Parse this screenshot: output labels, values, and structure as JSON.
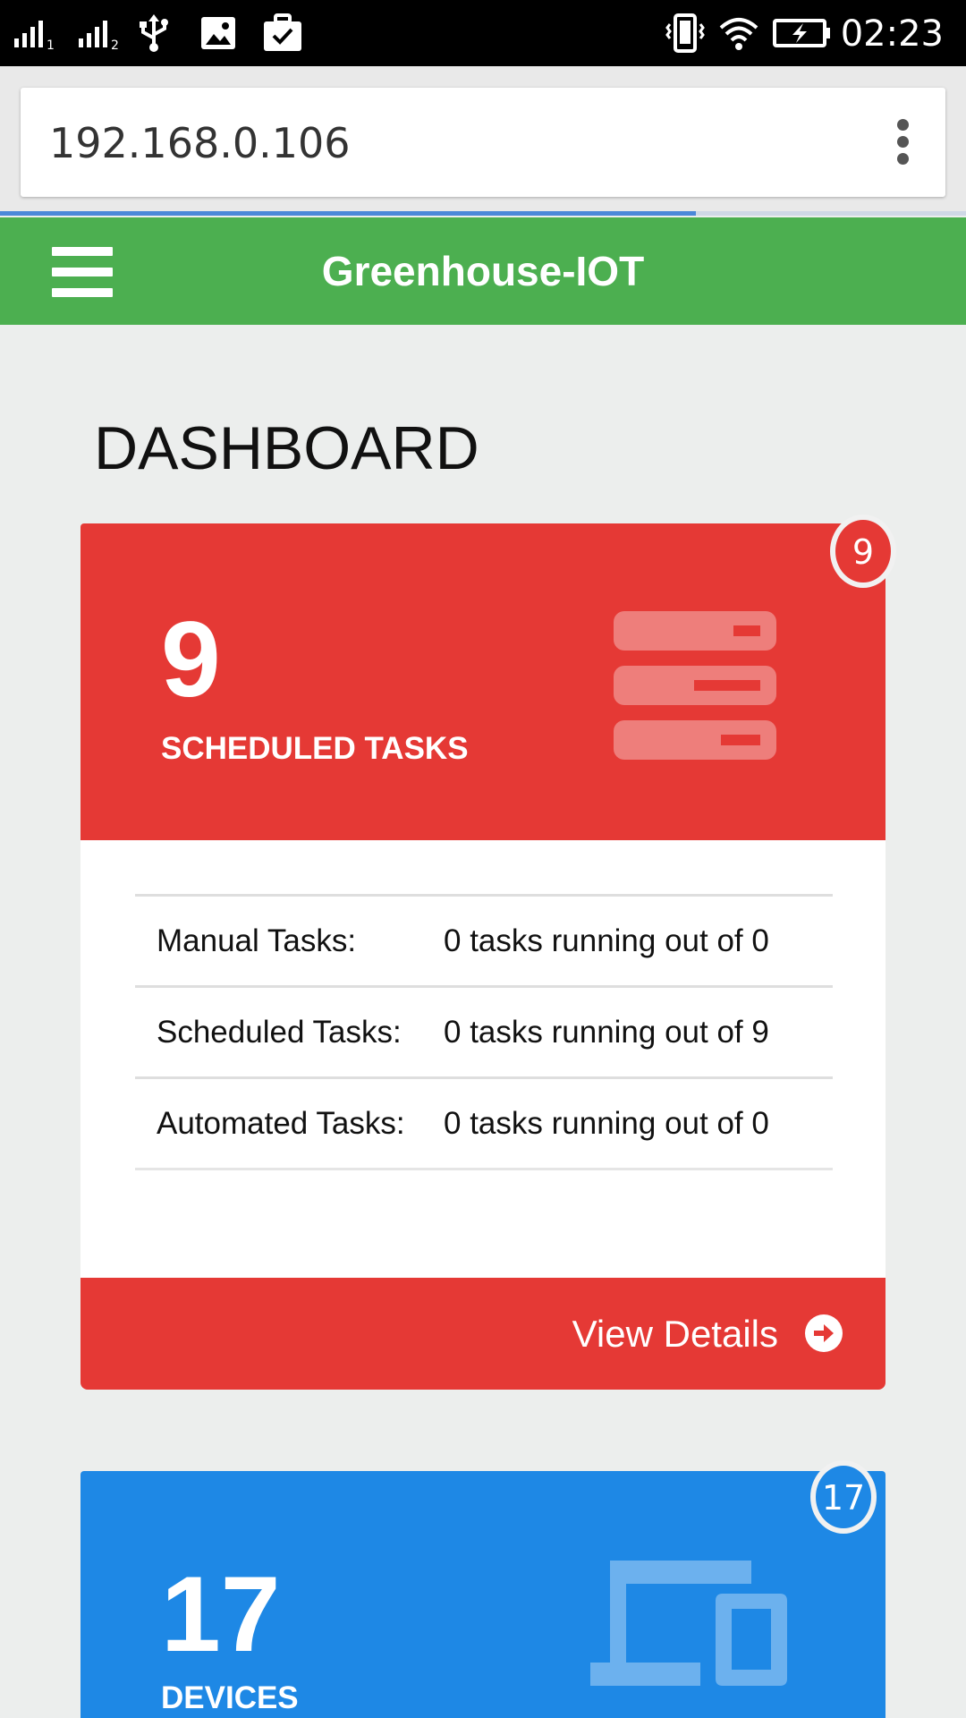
{
  "status_bar": {
    "time": "02:23",
    "icons": [
      "signal-sim1-icon",
      "signal-sim2-icon",
      "usb-icon",
      "image-icon",
      "briefcase-check-icon",
      "vibrate-icon",
      "wifi-icon",
      "battery-charging-icon"
    ]
  },
  "browser": {
    "url": "192.168.0.106",
    "menu_icon": "more-vert-icon",
    "load_progress": 0.72
  },
  "navbar": {
    "menu_icon": "hamburger-icon",
    "brand": "Greenhouse-IOT"
  },
  "page": {
    "title": "DASHBOARD"
  },
  "tasks_panel": {
    "color": "#e53935",
    "count": "9",
    "caption": "SCHEDULED TASKS",
    "badge": "9",
    "icon": "server-stack-icon",
    "rows": [
      {
        "label": "Manual Tasks:",
        "value": "0 tasks running out of 0"
      },
      {
        "label": "Scheduled Tasks:",
        "value": "0 tasks running out of 9"
      },
      {
        "label": "Automated Tasks:",
        "value": "0 tasks running out of 0"
      }
    ],
    "footer_label": "View Details",
    "footer_icon": "arrow-circle-right-icon"
  },
  "devices_panel": {
    "color": "#1e88e5",
    "count": "17",
    "caption": "DEVICES",
    "badge": "17",
    "icon": "laptop-tablet-icon"
  }
}
